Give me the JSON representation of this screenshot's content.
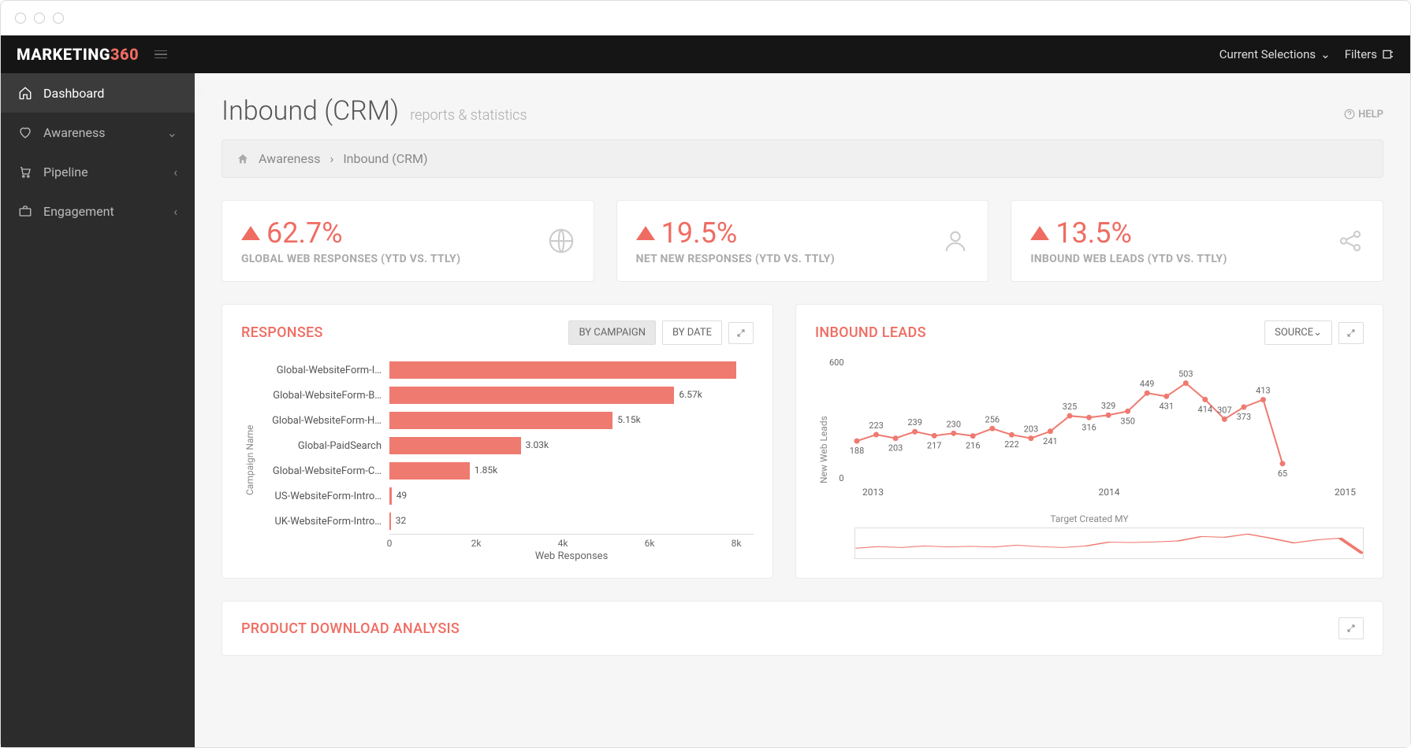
{
  "brand": {
    "main": "MARKETING",
    "accent": "360"
  },
  "topnav": {
    "selections": "Current Selections",
    "filters": "Filters"
  },
  "sidebar": {
    "items": [
      {
        "label": "Dashboard",
        "icon": "home",
        "active": true,
        "expandable": false
      },
      {
        "label": "Awareness",
        "icon": "heart",
        "active": false,
        "expandable": true
      },
      {
        "label": "Pipeline",
        "icon": "cart",
        "active": false,
        "expandable": true
      },
      {
        "label": "Engagement",
        "icon": "briefcase",
        "active": false,
        "expandable": true
      }
    ]
  },
  "page": {
    "title": "Inbound (CRM)",
    "subtitle": "reports & statistics",
    "help": "HELP"
  },
  "breadcrumb": {
    "root": "Awareness",
    "current": "Inbound (CRM)"
  },
  "kpis": [
    {
      "value": "62.7%",
      "label": "GLOBAL WEB RESPONSES (YTD VS. TTLY)",
      "icon": "globe"
    },
    {
      "value": "19.5%",
      "label": "NET NEW RESPONSES (YTD VS. TTLY)",
      "icon": "user"
    },
    {
      "value": "13.5%",
      "label": "INBOUND WEB LEADS (YTD VS. TTLY)",
      "icon": "share"
    }
  ],
  "responses_panel": {
    "title": "RESPONSES",
    "tab_campaign": "BY CAMPAIGN",
    "tab_date": "BY DATE"
  },
  "leads_panel": {
    "title": "INBOUND LEADS",
    "source_btn": "SOURCE"
  },
  "bottom_panel": {
    "title": "PRODUCT DOWNLOAD ANALYSIS"
  },
  "chart_data": {
    "responses": {
      "type": "bar",
      "orientation": "horizontal",
      "ylabel": "Campaign Name",
      "xlabel": "Web Responses",
      "xmax": 8000,
      "ticks": [
        "0",
        "2k",
        "4k",
        "6k",
        "8k"
      ],
      "categories": [
        "Global-WebsiteForm-I…",
        "Global-WebsiteForm-B…",
        "Global-WebsiteForm-H…",
        "Global-PaidSearch",
        "Global-WebsiteForm-C…",
        "US-WebsiteForm-Intro…",
        "UK-WebsiteForm-Intro…"
      ],
      "values": [
        8000,
        6570,
        5150,
        3030,
        1850,
        49,
        32
      ],
      "value_labels": [
        "",
        "6.57k",
        "5.15k",
        "3.03k",
        "1.85k",
        "49",
        "32"
      ]
    },
    "leads": {
      "type": "line",
      "ylabel": "New Web Leads",
      "xlabel_mini": "Target Created MY",
      "ylim": [
        0,
        600
      ],
      "yticks": [
        0,
        600
      ],
      "xticks": [
        "2013",
        "2014",
        "2015"
      ],
      "series": [
        {
          "name": "New Web Leads",
          "values": [
            188,
            223,
            203,
            239,
            217,
            230,
            216,
            256,
            222,
            203,
            241,
            325,
            316,
            329,
            350,
            449,
            431,
            503,
            414,
            307,
            373,
            413,
            65
          ]
        }
      ]
    }
  }
}
